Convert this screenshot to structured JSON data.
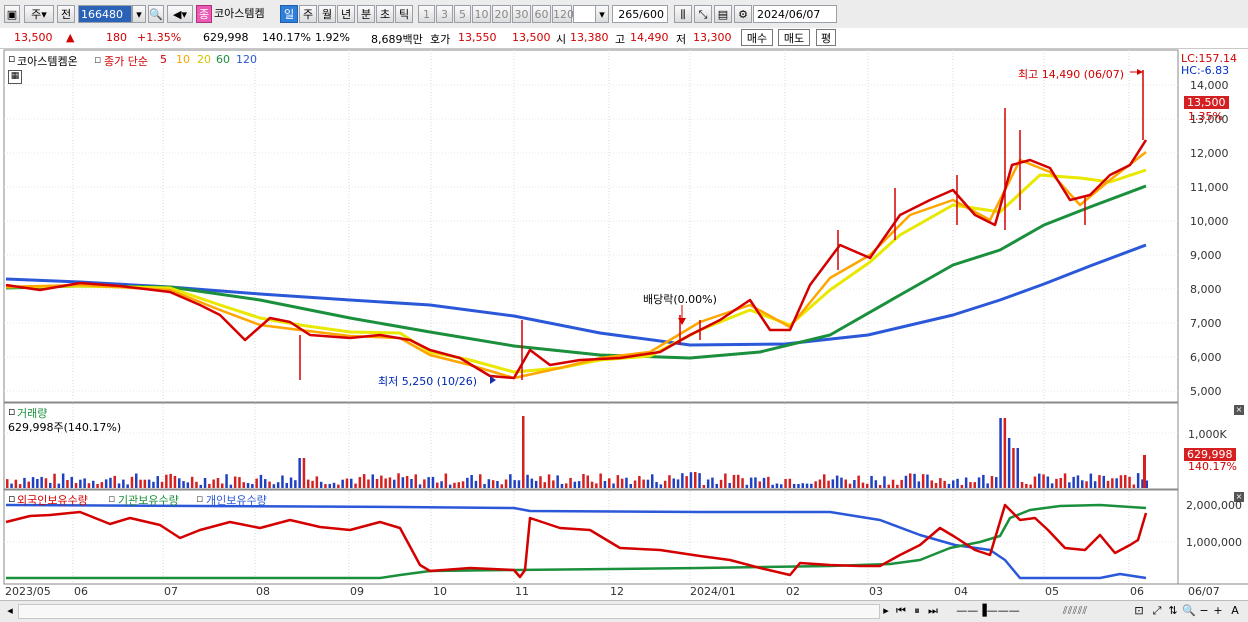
{
  "toolbar": {
    "market_type": "주",
    "prefix": "전",
    "code": "166480",
    "badge": "종",
    "stock_name": "코아스템켐",
    "periods": [
      "일",
      "주",
      "월",
      "년",
      "분",
      "초",
      "틱"
    ],
    "selected_period": "일",
    "intervals": [
      "1",
      "3",
      "5",
      "10",
      "20",
      "30",
      "60",
      "120"
    ],
    "count_value": "265",
    "count_total": "/600",
    "date": "2024/06/07"
  },
  "info": {
    "price": "13,500",
    "change": "180",
    "change_pct": "+1.35%",
    "volume": "629,998",
    "volume_pct": "140.17%",
    "turnover_rate": "1.92%",
    "amount": "8,689백만",
    "quote_label": "호가",
    "ask": "13,550",
    "bid": "13,500",
    "open_label": "시",
    "open": "13,380",
    "high_label": "고",
    "high": "14,490",
    "low_label": "저",
    "low": "13,300",
    "buy_btn": "매수",
    "sell_btn": "매도",
    "eval_btn": "평"
  },
  "price_pane": {
    "title": "코아스템켐온",
    "legend_label": "종가 단순",
    "ma_legend": [
      "5",
      "10",
      "20",
      "60",
      "120"
    ],
    "ma_colors": [
      "#d40000",
      "#ffa500",
      "#e8e800",
      "#1a8f3c",
      "#2a58d8"
    ],
    "lc": "LC:157.14",
    "hc": "HC:-6.83",
    "current_box": "13,500",
    "current_pct": "1.35%",
    "high_annotation": "최고 14,490 (06/07)",
    "low_annotation": "최저 5,250 (10/26)",
    "dividend_annotation": "배당락(0.00%)",
    "y_ticks": [
      "14,000",
      "13,000",
      "12,000",
      "11,000",
      "10,000",
      "9,000",
      "8,000",
      "7,000",
      "6,000",
      "5,000"
    ]
  },
  "volume_pane": {
    "title": "거래량",
    "value": "629,998주(140.17%)",
    "tick": "1,000K",
    "current_box": "629,998",
    "current_pct": "140.17%"
  },
  "holdings_pane": {
    "legend": [
      "외국인보유수량",
      "기관보유수량",
      "개인보유수량"
    ],
    "ticks": [
      "2,000,000",
      "1,000,000"
    ]
  },
  "x_axis": [
    "2023/05",
    "06",
    "07",
    "08",
    "09",
    "10",
    "11",
    "12",
    "2024/01",
    "02",
    "03",
    "04",
    "05",
    "06",
    "06/07"
  ],
  "bottom_nav": {
    "zoom_minus": "−",
    "zoom_plus": "+",
    "auto": "A"
  }
}
